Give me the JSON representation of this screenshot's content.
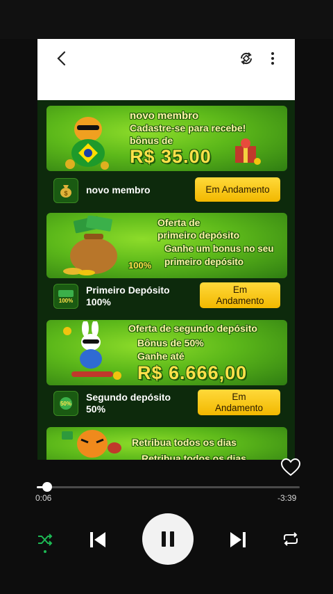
{
  "player": {
    "elapsed": "0:06",
    "remaining": "-3:39",
    "progress_fraction": 0.04,
    "accent": "#1db954"
  },
  "promos": [
    {
      "banner_lines": [
        "novo membro",
        "Cadastre-se para recebe!",
        "bônus de",
        "R$ 35.00"
      ],
      "label": "novo membro",
      "button": "Em Andamento",
      "icon": "money-bag-icon"
    },
    {
      "banner_lines": [
        "Oferta de",
        "primeiro depósito",
        "Ganhe um bonus no seu",
        "primeiro depósito",
        "100%"
      ],
      "label": "Primeiro Depósito\n100%",
      "button": "Em\nAndamento",
      "icon": "100-percent-icon"
    },
    {
      "banner_lines": [
        "Oferta de segundo depósito",
        "Bônus de 50%",
        "Ganhe até",
        "R$ 6.666,00"
      ],
      "label": "Segundo depósito\n50%",
      "button": "Em\nAndamento",
      "icon": "50-percent-icon"
    },
    {
      "banner_lines": [
        "Retribua todos os dias",
        "Retribua todos os dias"
      ]
    }
  ],
  "colors": {
    "button_yellow": "#f6c400",
    "banner_green": "#5cb81a",
    "page_bg": "#0d2a0c"
  }
}
